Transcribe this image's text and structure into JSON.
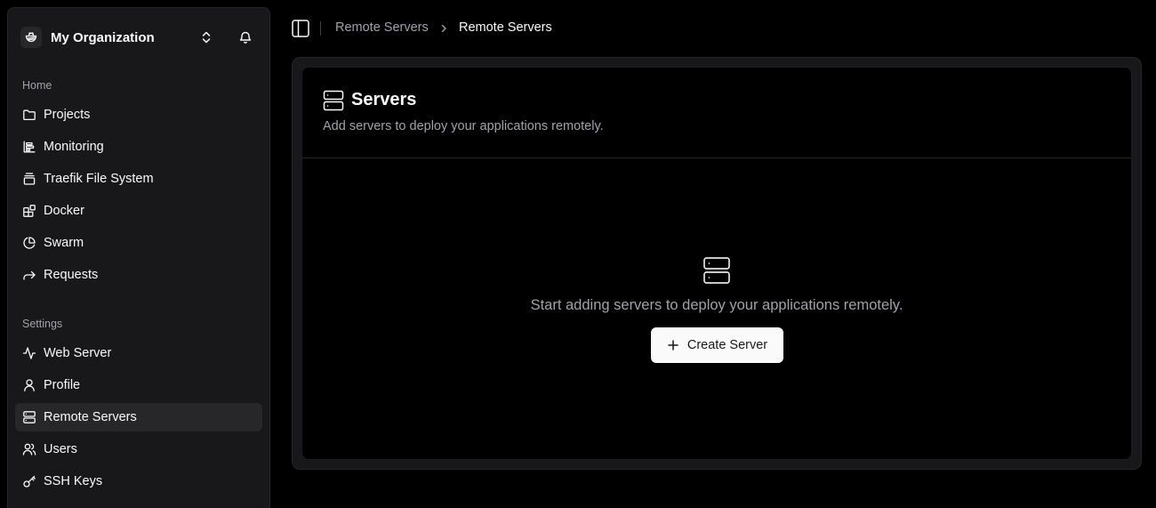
{
  "sidebar": {
    "org_name": "My Organization",
    "home_label": "Home",
    "home_items": [
      {
        "label": "Projects",
        "icon": "folder-icon"
      },
      {
        "label": "Monitoring",
        "icon": "bar-chart-icon"
      },
      {
        "label": "Traefik File System",
        "icon": "file-stack-icon"
      },
      {
        "label": "Docker",
        "icon": "blocks-icon"
      },
      {
        "label": "Swarm",
        "icon": "pie-chart-icon"
      },
      {
        "label": "Requests",
        "icon": "forward-icon"
      }
    ],
    "settings_label": "Settings",
    "settings_items": [
      {
        "label": "Web Server",
        "icon": "activity-icon"
      },
      {
        "label": "Profile",
        "icon": "user-icon"
      },
      {
        "label": "Remote Servers",
        "icon": "server-icon",
        "active": true
      },
      {
        "label": "Users",
        "icon": "users-icon"
      },
      {
        "label": "SSH Keys",
        "icon": "key-icon"
      }
    ]
  },
  "header": {
    "breadcrumb_parent": "Remote Servers",
    "breadcrumb_current": "Remote Servers"
  },
  "card": {
    "title": "Servers",
    "description": "Add servers to deploy your applications remotely.",
    "empty_text": "Start adding servers to deploy your applications remotely.",
    "create_button": "Create Server"
  },
  "colors": {
    "background": "#000000",
    "sidebar_bg": "#18181b",
    "active_item_bg": "#27272a",
    "muted_text": "#a1a1aa",
    "primary_button_bg": "#fafafa"
  }
}
